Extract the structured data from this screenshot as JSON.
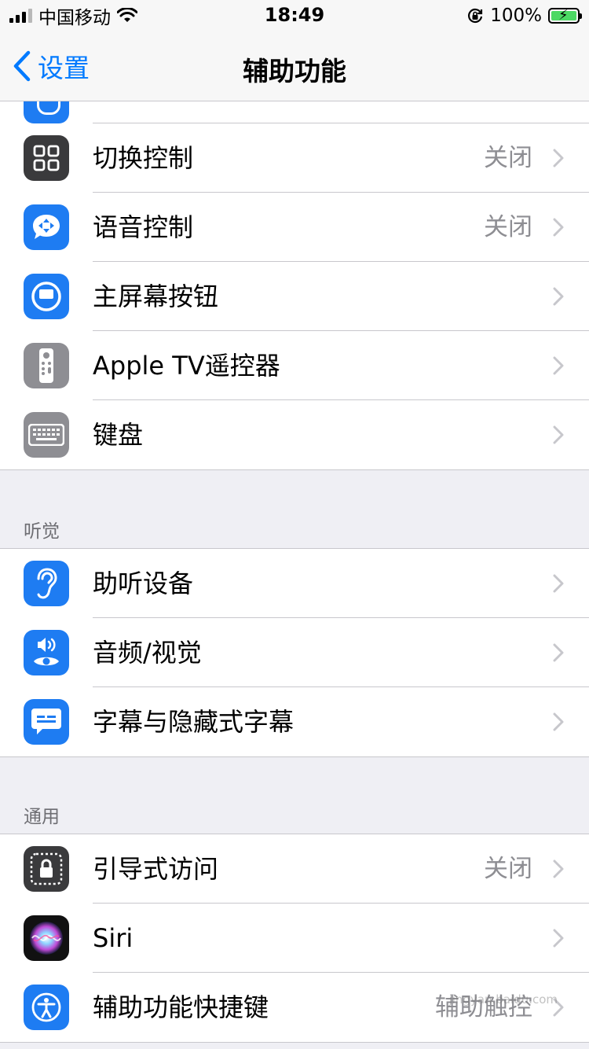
{
  "status_bar": {
    "carrier": "中国移动",
    "time": "18:49",
    "battery_percent": "100%"
  },
  "nav": {
    "back_label": "设置",
    "title": "辅助功能"
  },
  "groups": {
    "physical": [
      {
        "label": "切换控制",
        "value": "关闭",
        "icon": "switch-control-icon",
        "color": "#3a3a3c"
      },
      {
        "label": "语音控制",
        "value": "关闭",
        "icon": "voice-control-icon",
        "color": "#1e7cf2"
      },
      {
        "label": "主屏幕按钮",
        "value": "",
        "icon": "home-button-icon",
        "color": "#1e7cf2"
      },
      {
        "label": "Apple TV遥控器",
        "value": "",
        "icon": "remote-icon",
        "color": "#8e8e93"
      },
      {
        "label": "键盘",
        "value": "",
        "icon": "keyboard-icon",
        "color": "#8e8e93"
      }
    ],
    "hearing": {
      "header": "听觉",
      "items": [
        {
          "label": "助听设备",
          "value": "",
          "icon": "ear-icon",
          "color": "#1e7cf2"
        },
        {
          "label": "音频/视觉",
          "value": "",
          "icon": "audio-visual-icon",
          "color": "#1e7cf2"
        },
        {
          "label": "字幕与隐藏式字幕",
          "value": "",
          "icon": "subtitles-icon",
          "color": "#1e7cf2"
        }
      ]
    },
    "general": {
      "header": "通用",
      "items": [
        {
          "label": "引导式访问",
          "value": "关闭",
          "icon": "guided-access-icon",
          "color": "#3a3a3c"
        },
        {
          "label": "Siri",
          "value": "",
          "icon": "siri-icon",
          "color": "#111111"
        },
        {
          "label": "辅助功能快捷键",
          "value": "辅助触控",
          "icon": "accessibility-icon",
          "color": "#1e7cf2"
        }
      ]
    }
  },
  "watermark": {
    "text": "jingyan.baidu.com"
  }
}
